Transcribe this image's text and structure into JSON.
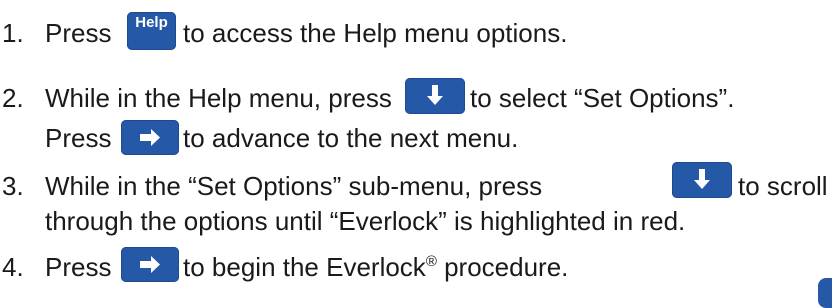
{
  "steps": [
    {
      "number": "1.",
      "before": "Press",
      "key": "Help",
      "after": "to access the Help menu options."
    },
    {
      "number": "2.",
      "line1_before": "While in the Help menu, press",
      "line1_after": "to select “Set Options”.",
      "line2_before": "Press",
      "line2_after": "to advance to the next menu."
    },
    {
      "number": "3.",
      "line1_before": "While in the “Set Options” sub-menu, press",
      "line1_after": "to scroll",
      "line2": "through the options until “Everlock” is highlighted in red."
    },
    {
      "number": "4.",
      "before": "Press",
      "after_pre": "to begin the Everlock",
      "after_sup": "®",
      "after_post": " procedure."
    }
  ],
  "icons": {
    "help_key": "help-key-icon",
    "down_arrow": "down-arrow-key-icon",
    "right_arrow": "right-arrow-key-icon"
  },
  "colors": {
    "key_blue": "#2559a7",
    "text": "#1a1a1a"
  }
}
